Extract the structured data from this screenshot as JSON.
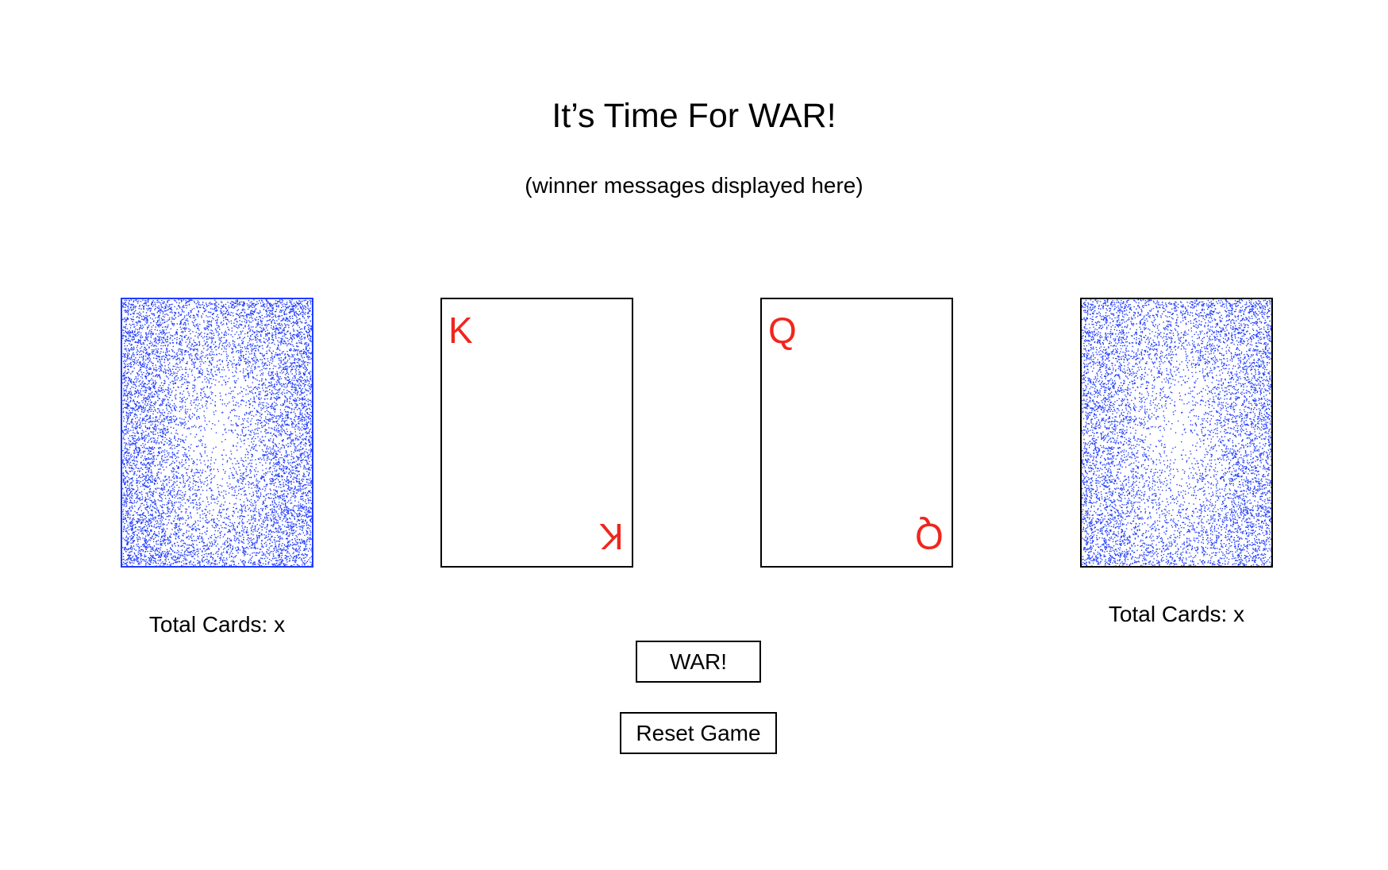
{
  "header": {
    "title": "It’s Time For WAR!",
    "message": "(winner messages displayed here)"
  },
  "player1": {
    "deck_icon": "card-back",
    "played_card": {
      "rank": "K",
      "suit_color": "#f0261d"
    },
    "total_cards": "Total Cards: x"
  },
  "player2": {
    "deck_icon": "card-back",
    "played_card": {
      "rank": "Q",
      "suit_color": "#f0261d"
    },
    "total_cards": "Total Cards: x"
  },
  "controls": {
    "war_label": "WAR!",
    "reset_label": "Reset Game"
  },
  "colors": {
    "card_back": "#1f3bff",
    "rank_red": "#f0261d"
  }
}
